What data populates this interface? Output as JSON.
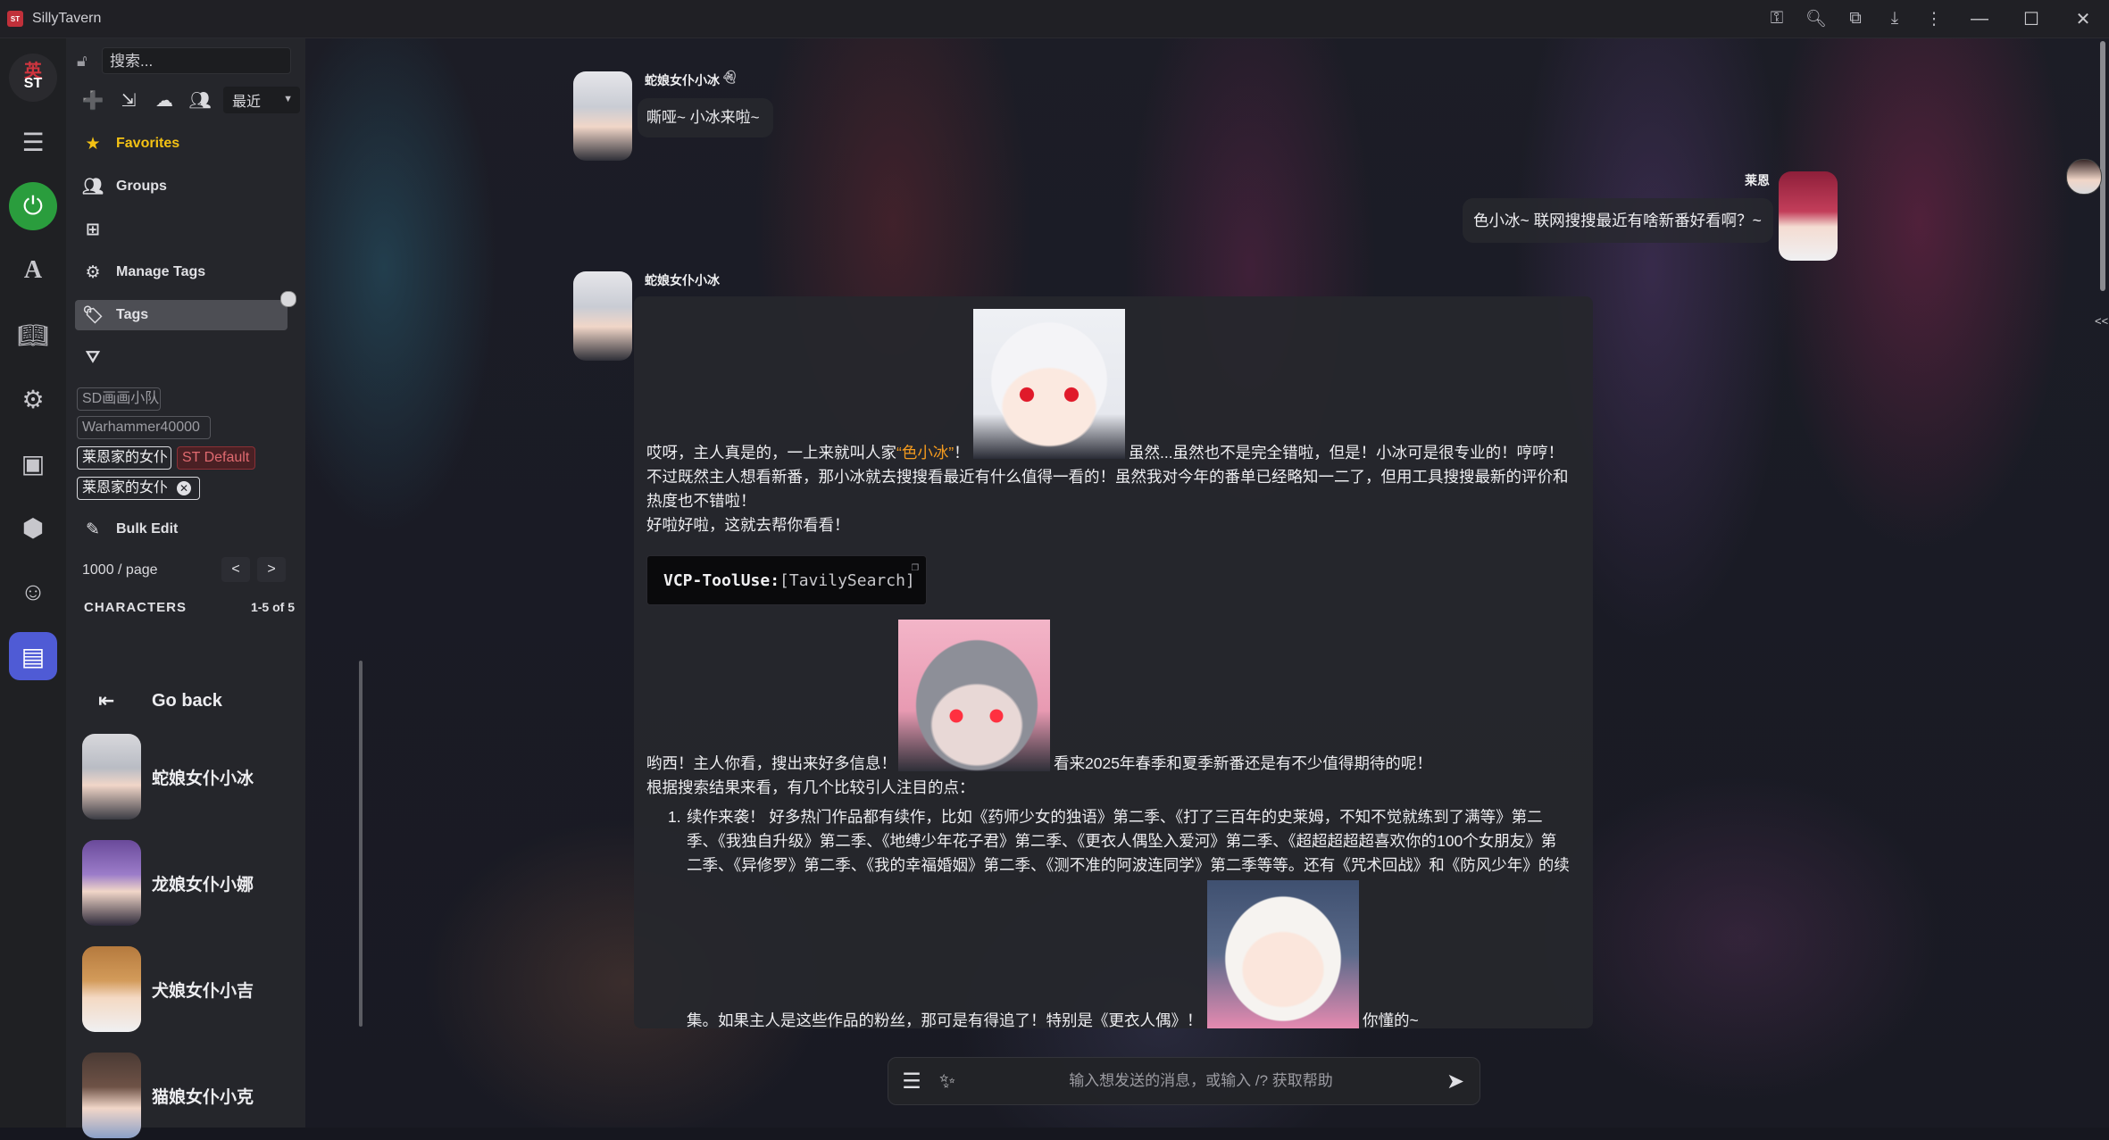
{
  "window": {
    "title": "SillyTavern",
    "app_icon_text": "ST"
  },
  "titlebar_icons": [
    "key-icon",
    "zoom-icon",
    "extension-icon",
    "download-icon",
    "more-icon"
  ],
  "window_controls": {
    "minimize": "—",
    "maximize": "☐",
    "close": "✕"
  },
  "rail": {
    "logo_top": "英",
    "logo_bottom": "ST",
    "items": [
      "sliders-icon",
      "plug-icon",
      "font-icon",
      "book-icon",
      "user-gear-icon",
      "image-icon",
      "cubes-icon",
      "smile-icon",
      "id-card-icon"
    ]
  },
  "panel": {
    "search_placeholder": "搜索...",
    "sort_value": "最近",
    "menu": {
      "favorites": "Favorites",
      "groups": "Groups",
      "manage_tags": "Manage Tags",
      "tags": "Tags",
      "bulk_edit": "Bulk Edit"
    },
    "tags": {
      "t1": "SD画画小队",
      "t2": "Warhammer40000",
      "t3": "莱恩家的女仆",
      "t4": "ST Default",
      "t5": "莱恩家的女仆"
    },
    "page_size": "1000 / page",
    "prev": "<",
    "next": ">",
    "characters_title": "CHARACTERS",
    "characters_count": "1-5 of 5",
    "go_back": "Go back",
    "characters": [
      {
        "name": "蛇娘女仆小冰"
      },
      {
        "name": "龙娘女仆小娜"
      },
      {
        "name": "犬娘女仆小吉"
      },
      {
        "name": "猫娘女仆小克"
      }
    ]
  },
  "chat": {
    "m1": {
      "name": "蛇娘女仆小冰",
      "text": "嘶哑~ 小冰来啦~"
    },
    "m2": {
      "name": "莱恩",
      "text": "色小冰~ 联网搜搜最近有啥新番好看啊？~"
    },
    "m3": {
      "name": "蛇娘女仆小冰",
      "p1_a": "哎呀，主人真是的，一上来就叫人家",
      "p1_hl": "“色小冰”",
      "p1_b": "！",
      "p1_c": "虽然...虽然也不是完全错啦，但是！小冰可是很专业的！哼哼！",
      "p1_d": "不过既然主人想看新番，那小冰就去搜搜看最近有什么值得一看的！虽然我对今年的番单已经略知一二了，但用工具搜搜最新的评价和",
      "p1_e": "热度也不错啦！",
      "p2": "好啦好啦，这就去帮你看看！",
      "code_key": "VCP-ToolUse:",
      "code_val": "[TavilySearch]",
      "p3_a": "哟西！主人你看，搜出来好多信息！",
      "p3_b": "看来2025年春季和夏季新番还是有不少值得期待的呢！",
      "p4": "根据搜索结果来看，有几个比较引人注目的点：",
      "li_num": "1.",
      "li_1a": "续作来袭！ 好多热门作品都有续作，比如《药师少女的独语》第二季、《打了三百年的史莱姆，不知不觉就练到了满等》第二",
      "li_1b": "季、《我独自升级》第二季、《地缚少年花子君》第二季、《更衣人偶坠入爱河》第二季、《超超超超超喜欢你的100个女朋友》第",
      "li_1c": "二季、《异修罗》第二季、《我的幸福婚姻》第二季、《测不准的阿波连同学》第二季等等。还有《咒术回战》和《防风少年》的续",
      "li_1d": "集。如果主人是这些作品的粉丝，那可是有得追了！特别是《更衣人偶》！",
      "li_1e": "你懂的~"
    }
  },
  "input": {
    "placeholder": "输入想发送的消息，或输入 /? 获取帮助"
  },
  "colors": {
    "accent": "#4f5bd5",
    "green": "#2a9d3d",
    "favorite": "#f3c114",
    "highlight": "#f39a1e"
  }
}
